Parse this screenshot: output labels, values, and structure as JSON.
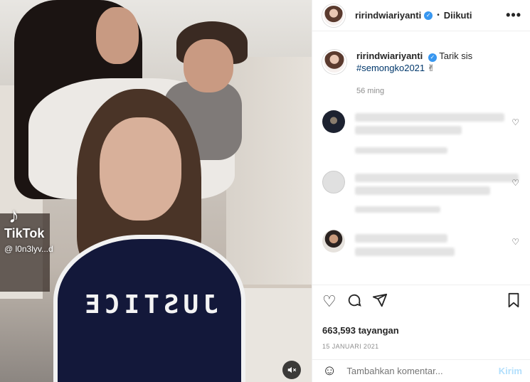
{
  "video": {
    "shirt_text": "JUSTICE",
    "watermark_name": "TikTok",
    "watermark_handle": "@ l0n3lyv...d"
  },
  "post": {
    "username": "ririndwiariyanti",
    "dot": "•",
    "follow_status": "Diikuti",
    "more": "•••",
    "caption_text": "Tarik sis",
    "caption_hashtag": "#semongko2021",
    "caption_emoji": "✌",
    "caption_time": "56 ming",
    "views": "663,593 tayangan",
    "date": "15 JANUARI 2021"
  },
  "comment_box": {
    "placeholder": "Tambahkan komentar...",
    "post_label": "Kirim"
  },
  "colors": {
    "verified": "#3897f0",
    "hashtag": "#00376b",
    "post_button": "#b2dffc",
    "shirt": "#13183a"
  },
  "icons": [
    "volume-mute-icon",
    "verified-icon",
    "more-icon",
    "heart-icon",
    "comment-icon",
    "share-icon",
    "bookmark-icon",
    "emoji-icon"
  ]
}
